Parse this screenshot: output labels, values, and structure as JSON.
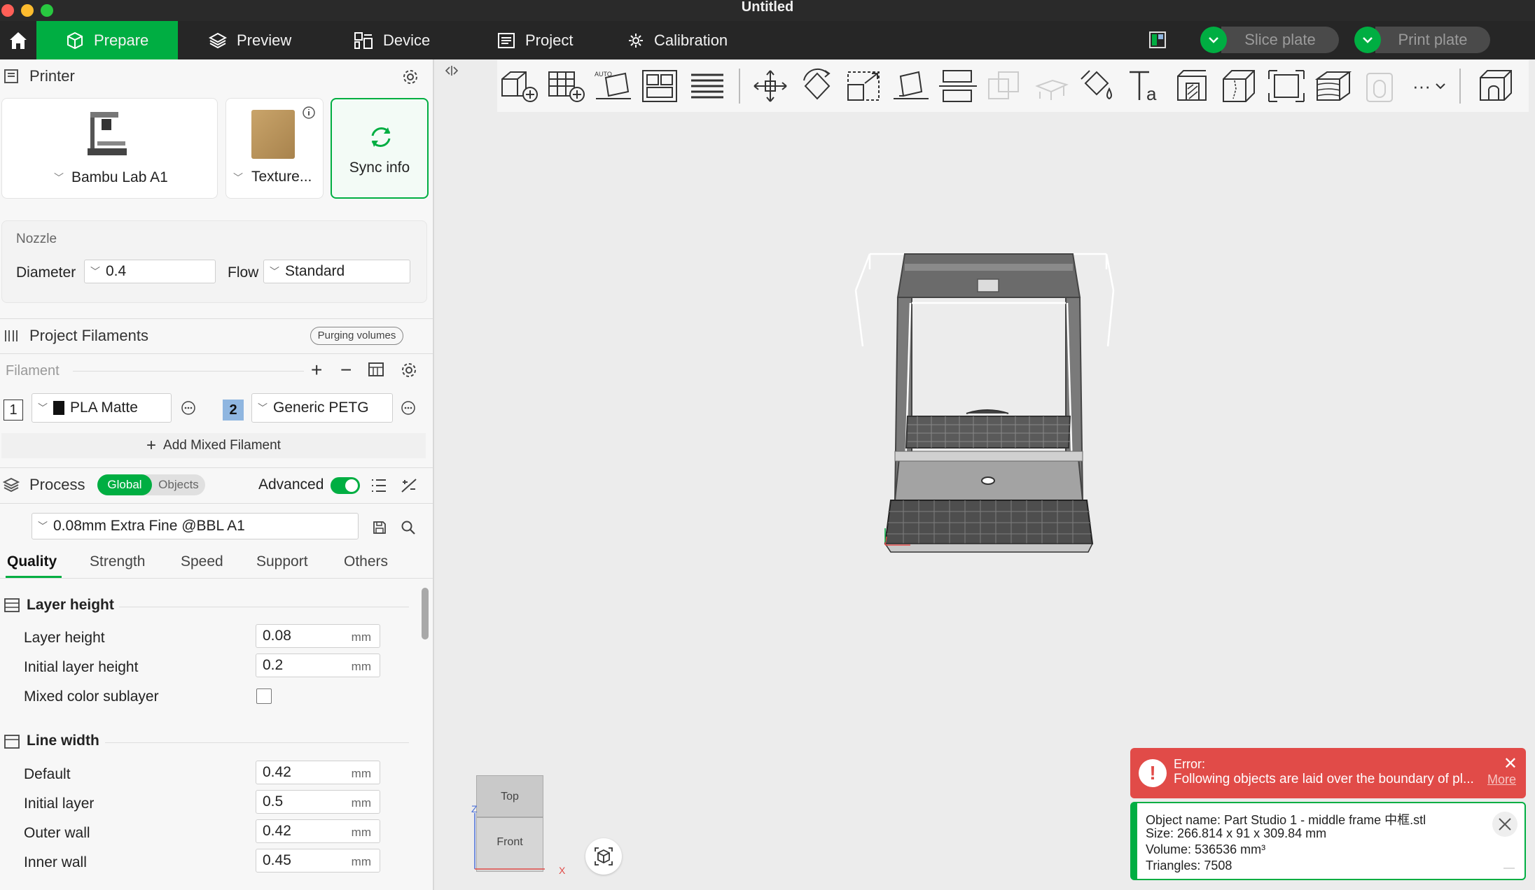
{
  "window": {
    "title": "Untitled"
  },
  "nav": {
    "tabs": [
      {
        "label": "Prepare",
        "icon": "cube-icon"
      },
      {
        "label": "Preview",
        "icon": "layers-icon"
      },
      {
        "label": "Device",
        "icon": "device-icon"
      },
      {
        "label": "Project",
        "icon": "project-icon"
      },
      {
        "label": "Calibration",
        "icon": "calibration-icon"
      }
    ],
    "slice_label": "Slice plate",
    "print_label": "Print plate"
  },
  "printer": {
    "section_title": "Printer",
    "printer_name": "Bambu Lab A1",
    "plate_name": "Texture...",
    "sync_label": "Sync info"
  },
  "nozzle": {
    "title": "Nozzle",
    "diameter_label": "Diameter",
    "diameter_value": "0.4",
    "flow_label": "Flow",
    "flow_value": "Standard"
  },
  "filaments": {
    "title": "Project Filaments",
    "purging_label": "Purging volumes",
    "filament_label": "Filament",
    "items": [
      {
        "index": "1",
        "name": "PLA Matte",
        "color": "#111111"
      },
      {
        "index": "2",
        "name": "Generic PETG",
        "color": "#8fb6e0"
      }
    ],
    "add_mixed_label": "Add Mixed Filament"
  },
  "process": {
    "title": "Process",
    "toggle_global": "Global",
    "toggle_objects": "Objects",
    "advanced_label": "Advanced",
    "advanced_on": true,
    "preset": "0.08mm Extra Fine @BBL A1",
    "tabs": [
      "Quality",
      "Strength",
      "Speed",
      "Support",
      "Others"
    ],
    "active_tab": "Quality",
    "groups": [
      {
        "title": "Layer height",
        "rows": [
          {
            "label": "Layer height",
            "value": "0.08",
            "unit": "mm"
          },
          {
            "label": "Initial layer height",
            "value": "0.2",
            "unit": "mm"
          },
          {
            "label": "Mixed color sublayer",
            "checkbox": false
          }
        ]
      },
      {
        "title": "Line width",
        "rows": [
          {
            "label": "Default",
            "value": "0.42",
            "unit": "mm"
          },
          {
            "label": "Initial layer",
            "value": "0.5",
            "unit": "mm"
          },
          {
            "label": "Outer wall",
            "value": "0.42",
            "unit": "mm"
          },
          {
            "label": "Inner wall",
            "value": "0.45",
            "unit": "mm"
          }
        ]
      }
    ]
  },
  "viewcube": {
    "top_label": "Top",
    "front_label": "Front",
    "axis_z": "Z",
    "axis_x": "X"
  },
  "notifications": {
    "error_title": "Error:",
    "error_text": "Following objects are laid over the boundary of pl...",
    "error_more": "More",
    "object_name": "Object name: Part Studio 1 - middle frame 中框.stl",
    "size": "Size: 266.814 x 91 x 309.84 mm",
    "volume": "Volume: 536536 mm³",
    "triangles": "Triangles: 7508"
  },
  "colors": {
    "accent": "#00ae42",
    "error": "#e14b48",
    "nav_bg": "#262626"
  }
}
